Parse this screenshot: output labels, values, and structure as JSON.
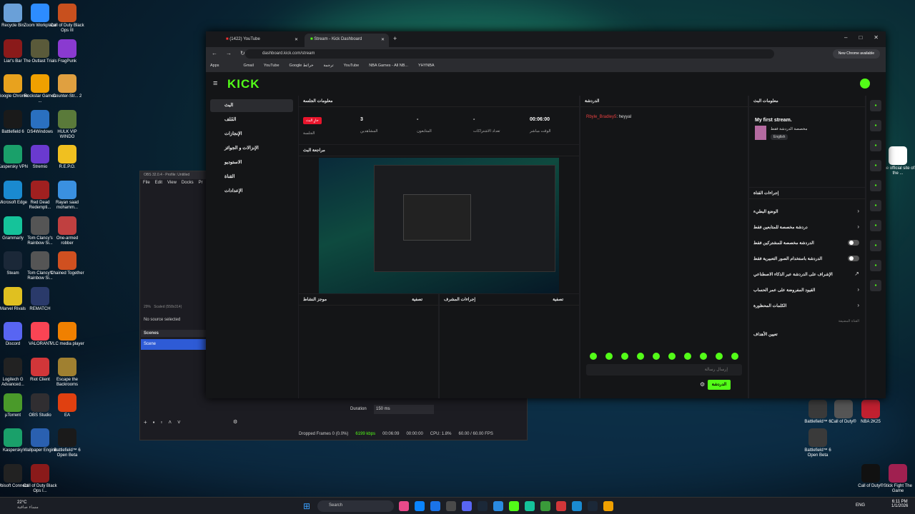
{
  "desktop": {
    "icons_left": [
      {
        "label": "Recycle Bin",
        "color": "#6aa0d8"
      },
      {
        "label": "Zoom Workplace",
        "color": "#2d8cff"
      },
      {
        "label": "Call of Duty Black Ops III",
        "color": "#c8501e"
      },
      {
        "label": "Liar's Bar",
        "color": "#8a1a1a"
      },
      {
        "label": "The Outlast Trials",
        "color": "#5a5a3a"
      },
      {
        "label": "FragPunk",
        "color": "#8a3ad0"
      },
      {
        "label": "Google Chrome",
        "color": "#e8a21e"
      },
      {
        "label": "Rockstar Games ...",
        "color": "#f0a000"
      },
      {
        "label": "Counter-Str... 2",
        "color": "#e0a040"
      },
      {
        "label": "Battlefield 6",
        "color": "#1a1a1a"
      },
      {
        "label": "DS4Windows",
        "color": "#2a70c0"
      },
      {
        "label": "HULK VIP WINDO",
        "color": "#5a7a3a"
      },
      {
        "label": "Kaspersky VPN",
        "color": "#1aa06a"
      },
      {
        "label": "Stremio",
        "color": "#6a3ad0"
      },
      {
        "label": "R.E.P.O.",
        "color": "#f0c020"
      },
      {
        "label": "Microsoft Edge",
        "color": "#1a8ad0"
      },
      {
        "label": "Red Dead Redempti...",
        "color": "#a02020"
      },
      {
        "label": "Rayan saad mohamm...",
        "color": "#3a90e0"
      },
      {
        "label": "Grammarly",
        "color": "#15c39a"
      },
      {
        "label": "Tom Clancy's Rainbow Si...",
        "color": "#555"
      },
      {
        "label": "One-armed robber",
        "color": "#c04040"
      },
      {
        "label": "Steam",
        "color": "#1b2838"
      },
      {
        "label": "Tom Clancy's Rainbow Si...",
        "color": "#555"
      },
      {
        "label": "Chained Together",
        "color": "#d05020"
      },
      {
        "label": "Marvel Rivals",
        "color": "#e0c020"
      },
      {
        "label": "REMATCH",
        "color": "#2a3a6a"
      },
      {
        "label": "Discord",
        "color": "#5865f2"
      },
      {
        "label": "VALORANT",
        "color": "#fa4454"
      },
      {
        "label": "VLC media player",
        "color": "#f08000"
      },
      {
        "label": "Logitech G Advanced...",
        "color": "#222"
      },
      {
        "label": "Riot Client",
        "color": "#d13639"
      },
      {
        "label": "Escape the Backrooms",
        "color": "#a08030"
      },
      {
        "label": "µTorrent",
        "color": "#4a9a2a"
      },
      {
        "label": "OBS Studio",
        "color": "#302e31"
      },
      {
        "label": "EA",
        "color": "#e04010"
      },
      {
        "label": "Kaspersky",
        "color": "#1aa06a"
      },
      {
        "label": "Wallpaper Engine",
        "color": "#2a60b0"
      },
      {
        "label": "Battlefield™ 6 Open Beta",
        "color": "#1a1a1a"
      },
      {
        "label": "Ubisoft Connect",
        "color": "#222"
      },
      {
        "label": "Call of Duty Black Ops I...",
        "color": "#8a1a1a"
      }
    ],
    "icons_right": [
      {
        "label": "The official site of the ...",
        "color": "#fff"
      },
      {
        "label": "Battlefield™ 6",
        "color": "#3a3a3a"
      },
      {
        "label": "Call of Duty®",
        "color": "#555"
      },
      {
        "label": "NBA 2K25",
        "color": "#c02030"
      },
      {
        "label": "Battlefield™ 6 Open Beta",
        "color": "#3a3a3a"
      },
      {
        "label": "Call of Duty®",
        "color": "#111"
      },
      {
        "label": "Stick Fight The Game",
        "color": "#a02050"
      }
    ]
  },
  "obs": {
    "title": "OBS 32.0.4 - Profile: Untitled",
    "menu": [
      "File",
      "Edit",
      "View",
      "Docks",
      "Pr"
    ],
    "zoom": "29%",
    "scaled": "Scaled (558x314)",
    "no_source": "No source selected",
    "scenes_header": "Scenes",
    "scene_item": "Scene",
    "duration_label": "Duration",
    "duration_value": "150 ms",
    "status": {
      "dropped": "Dropped Frames 0 (0.0%)",
      "kbps": "6199 kbps",
      "rec_time": "00:06:09",
      "stream_time": "00:00:00",
      "cpu": "CPU: 1.8%",
      "fps": "60.00 / 60.00 FPS"
    }
  },
  "chrome": {
    "tabs": [
      "(1422) YouTube",
      "Stream - Kick Dashboard"
    ],
    "url": "dashboard.kick.com/stream",
    "new_chrome": "New Chrome available",
    "bookmarks": [
      "Apps",
      "Gmail",
      "YouTube",
      "Google خرائط",
      "ترجمة",
      "YouTube",
      "NBA Games - All NB...",
      "YHYNBA"
    ]
  },
  "kick": {
    "logo": "KICK",
    "nav": [
      {
        "label": "البث"
      },
      {
        "label": "المُلف"
      },
      {
        "label": "الإنجازات"
      },
      {
        "label": "الإنزالات و الجوائز"
      },
      {
        "label": "الاستوديو"
      },
      {
        "label": "القناة"
      },
      {
        "label": "الإعدادات"
      }
    ],
    "session": {
      "header": "معلومات الجلسة",
      "live_badge": "جارٍ البث",
      "session_label": "الجلسة",
      "stats": [
        {
          "value": "3",
          "label": "المشاهدين"
        },
        {
          "value": "-",
          "label": "المتابعون"
        },
        {
          "value": "-",
          "label": "تعداد الاشتراكات"
        },
        {
          "value": "00:06:00",
          "label": "الوقت مباشر"
        }
      ]
    },
    "preview_header": "مراجعة البث",
    "activity_header": "موجز النشاط",
    "filter": "تصفية",
    "mod_header": "إجراءات المشرف",
    "chat": {
      "header": "الدردشة",
      "messages": [
        {
          "user": "Rbyle_Bradley5",
          "text": ": heyyal"
        }
      ],
      "placeholder": "إرسال رسالة",
      "send": "الدردشة"
    },
    "stream_info": {
      "header": "معلومات البث",
      "title": "My first stream.",
      "category": "مخصصة الدردشة فقط",
      "tag": "English"
    },
    "channel_actions": {
      "header": "إجراءات القناة",
      "items": [
        {
          "label": "الوضع البطيء",
          "kind": "arrow"
        },
        {
          "label": "دردشة مخصصة للمتابعين فقط",
          "kind": "arrow"
        },
        {
          "label": "الدردشة مخصصة للمشتركين فقط",
          "kind": "toggle"
        },
        {
          "label": "الدردشة باستخدام الصور التعبيرية فقط",
          "kind": "toggle"
        },
        {
          "label": "الإشراف على الدردشة عبر الذكاء الاصطناعي",
          "kind": "link"
        },
        {
          "label": "القيود المفروضة على عمر الحساب",
          "kind": "arrow"
        },
        {
          "label": "الكلمات المحظورة",
          "kind": "arrow"
        }
      ],
      "subheading": "القناة المضيفة",
      "host_item": "تعيين الأهداف"
    }
  },
  "taskbar": {
    "weather_temp": "22°C",
    "weather_desc": "مساء صافية",
    "search": "Search",
    "lang": "ENG",
    "time": "6:11 PM",
    "date": "1/1/2026"
  }
}
